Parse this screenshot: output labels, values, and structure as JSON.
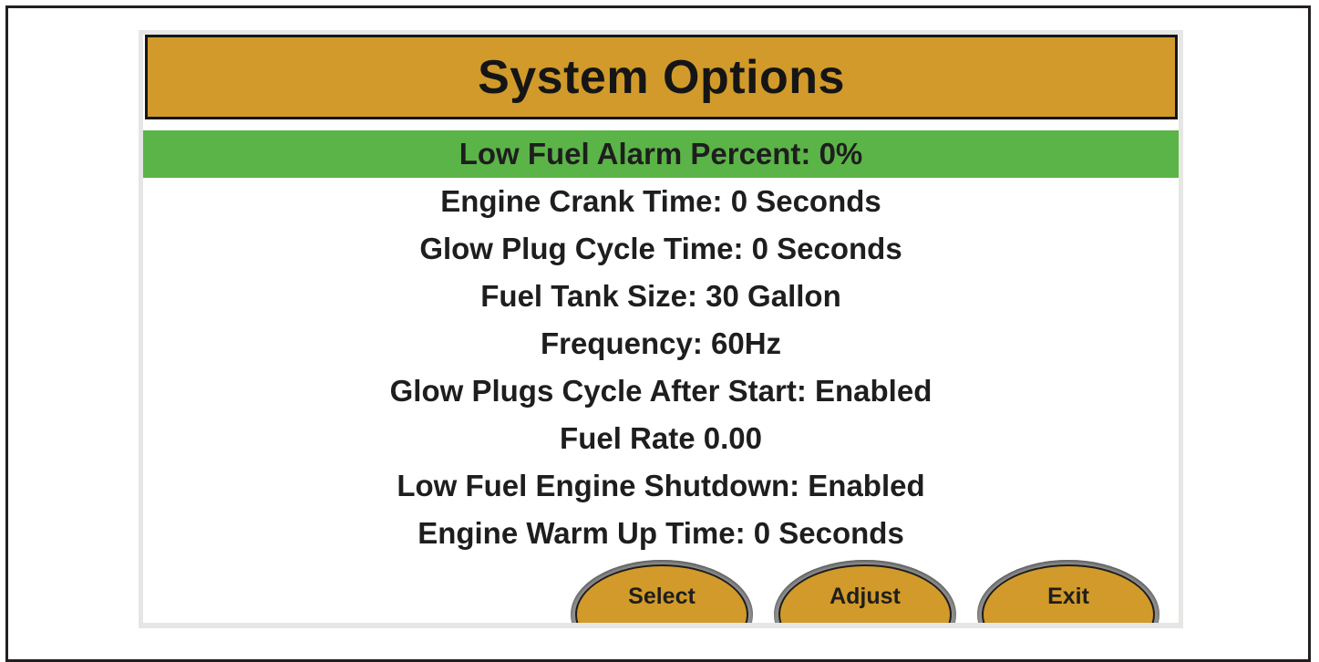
{
  "screen": {
    "title": "System Options"
  },
  "options": {
    "items": [
      {
        "label": "Low Fuel Alarm Percent: 0%",
        "selected": true
      },
      {
        "label": "Engine Crank Time: 0 Seconds",
        "selected": false
      },
      {
        "label": "Glow Plug Cycle Time: 0 Seconds",
        "selected": false
      },
      {
        "label": "Fuel Tank Size: 30 Gallon",
        "selected": false
      },
      {
        "label": "Frequency: 60Hz",
        "selected": false
      },
      {
        "label": "Glow Plugs Cycle After Start: Enabled",
        "selected": false
      },
      {
        "label": "Fuel Rate 0.00",
        "selected": false
      },
      {
        "label": "Low Fuel Engine Shutdown: Enabled",
        "selected": false
      },
      {
        "label": "Engine Warm Up Time: 0 Seconds",
        "selected": false
      }
    ]
  },
  "buttons": {
    "select_label": "Select",
    "adjust_label": "Adjust",
    "exit_label": "Exit"
  },
  "colors": {
    "title_bar": "#d19a2a",
    "selected_row": "#5bb447",
    "button_face": "#d19a2a",
    "text": "#1e1e1e"
  }
}
